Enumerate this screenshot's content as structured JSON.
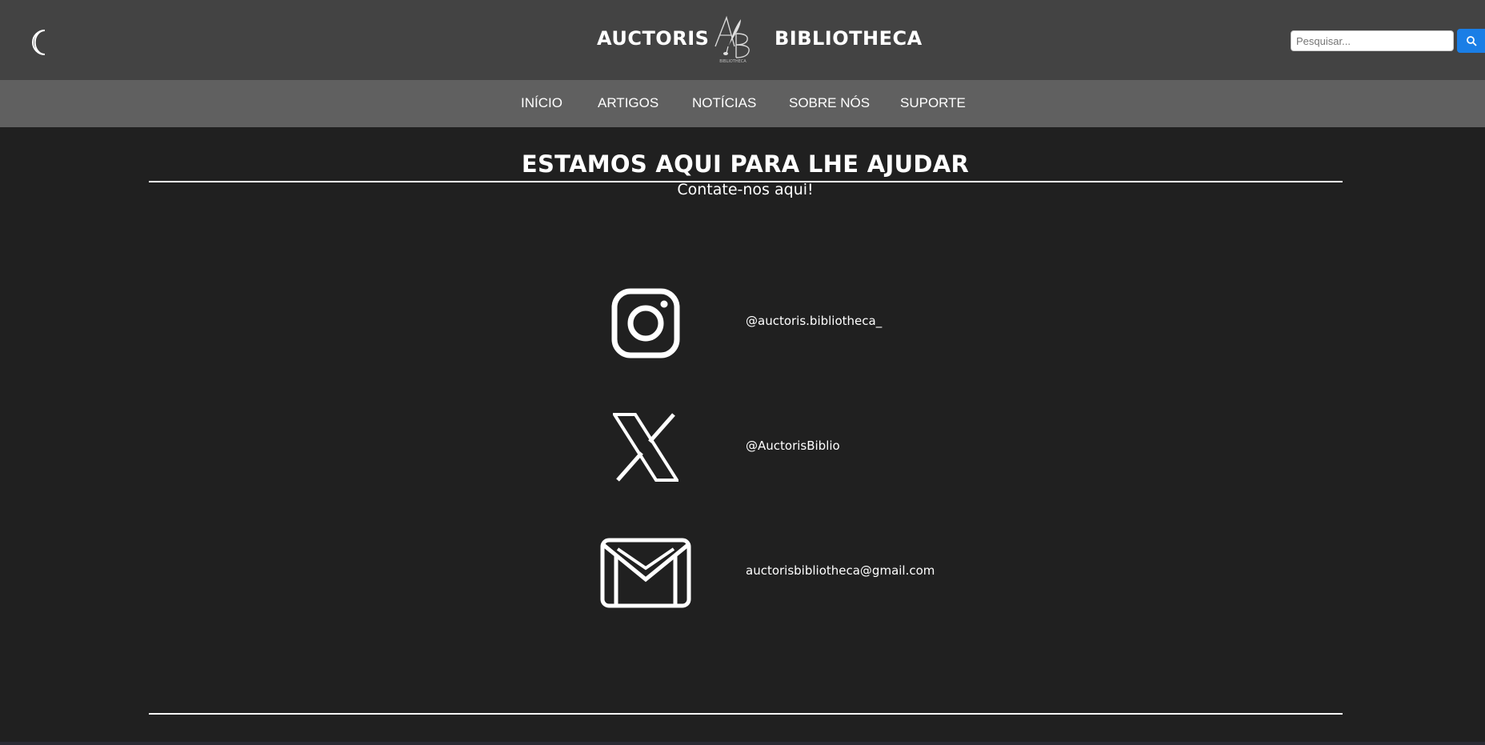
{
  "header": {
    "brand_left": "AUCTORIS",
    "brand_right": "BIBLIOTHECA",
    "logo_text": "BIBLIOTHECA",
    "search_placeholder": "Pesquisar..."
  },
  "nav": {
    "items": [
      "INÍCIO",
      "ARTIGOS",
      "NOTÍCIAS",
      "SOBRE NÓS",
      "SUPORTE"
    ]
  },
  "main": {
    "headline": "ESTAMOS AQUI PARA LHE AJUDAR",
    "subheadline": "Contate-nos aqui!",
    "contacts": [
      {
        "icon": "instagram-icon",
        "text": "@auctoris.bibliotheca_"
      },
      {
        "icon": "x-twitter-icon",
        "text": "@AuctorisBiblio"
      },
      {
        "icon": "mail-icon",
        "text": "auctorisbibliotheca@gmail.com"
      }
    ]
  },
  "colors": {
    "page_background": "#202020",
    "header_background": "#434343",
    "nav_background": "#606060",
    "search_button": "#1a7ee6",
    "text": "#ffffff"
  }
}
